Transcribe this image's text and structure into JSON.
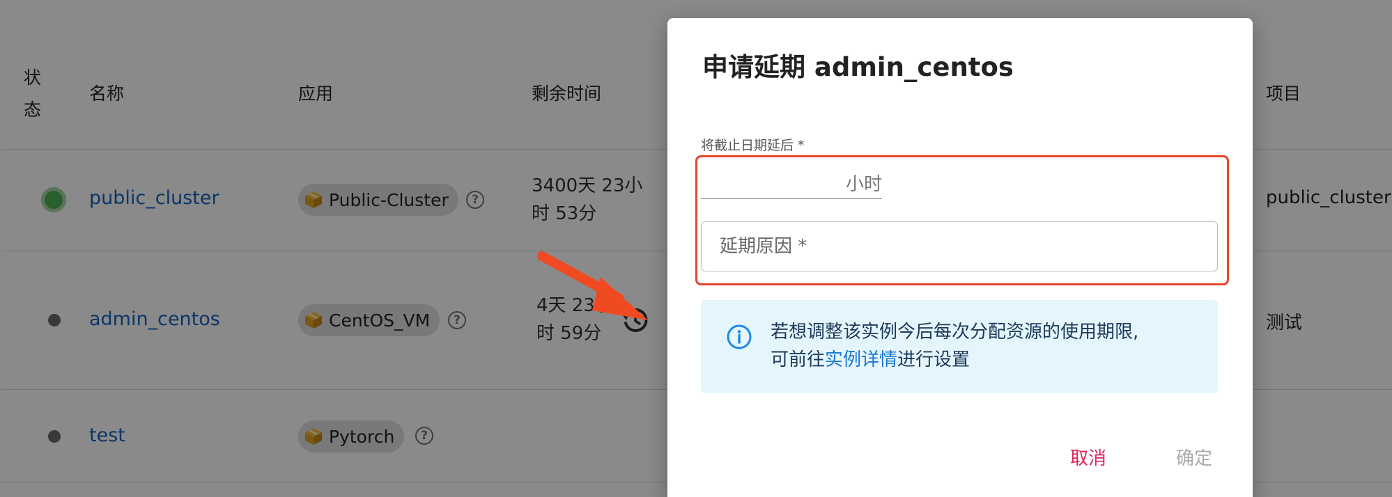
{
  "table": {
    "headers": {
      "status": "状\n态",
      "name": "名称",
      "app": "应用",
      "remaining": "剩余时间",
      "project": "项目"
    },
    "rows": [
      {
        "name": "public_cluster",
        "app": "Public-Cluster",
        "remaining": "3400天 23小\n时 53分",
        "project": "public_cluster",
        "status": "running"
      },
      {
        "name": "admin_centos",
        "app": "CentOS_VM",
        "remaining": "4天 23小\n时 59分",
        "project": "测试",
        "status": "stopped"
      },
      {
        "name": "test",
        "app": "Pytorch",
        "remaining": "",
        "project": "",
        "status": "stopped"
      }
    ]
  },
  "dialog": {
    "title": "申请延期 admin_centos",
    "extend_label": "将截止日期延后 *",
    "hours_value": "",
    "hours_suffix": "小时",
    "reason_placeholder": "延期原因 *",
    "info_text_1": "若想调整该实例今后每次分配资源的使用期限,",
    "info_text_2_prefix": "可前往",
    "info_link": "实例详情",
    "info_text_2_suffix": "进行设置",
    "cancel_label": "取消",
    "confirm_label": "确定"
  },
  "colors": {
    "link": "#1565c0",
    "cancel": "#e0245e",
    "confirm_disabled": "#aaaaaa",
    "highlight": "#e8452c",
    "status_running": "#4caf50",
    "info_bg": "#e5f5fc"
  },
  "icons": {
    "app": "cube-icon",
    "help": "help-circle-icon",
    "extend": "history-clock-icon",
    "info": "info-circle-icon",
    "annotation": "red-arrow"
  }
}
